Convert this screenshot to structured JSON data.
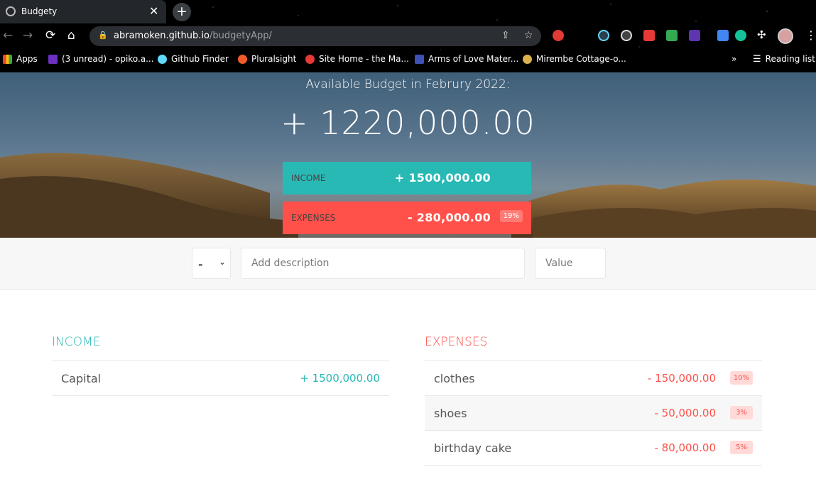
{
  "browser": {
    "tab_title": "Budgety",
    "tab_close": "✕",
    "new_tab": "+",
    "url_host": "abramoken.github.io",
    "url_path": "/budgetyApp/",
    "bookmarks": [
      {
        "label": "Apps",
        "color": "#e0533b"
      },
      {
        "label": "(3 unread) - opiko.a...",
        "color": "#6b2fc2"
      },
      {
        "label": "Github Finder",
        "color": "#61dafb"
      },
      {
        "label": "Pluralsight",
        "color": "#f15b2a"
      },
      {
        "label": "Site Home - the Ma...",
        "color": "#e53935"
      },
      {
        "label": "Arms of Love Mater...",
        "color": "#3f51b5"
      },
      {
        "label": "Mirembe Cottage-o...",
        "color": "#d9b24c"
      }
    ],
    "bookmarks_more": "»",
    "reading_list": "Reading list"
  },
  "header": {
    "title": "Available Budget in Februry 2022:",
    "budget": "+ 1220,000.00",
    "income_label": "Income",
    "income_value": "+ 1500,000.00",
    "expenses_label": "Expenses",
    "expenses_value": "- 280,000.00",
    "expenses_percent": "19%"
  },
  "add": {
    "type_value": "-",
    "description_placeholder": "Add description",
    "value_placeholder": "Value"
  },
  "income": {
    "title": "Income",
    "items": [
      {
        "description": "Capital",
        "value": "+ 1500,000.00"
      }
    ]
  },
  "expenses": {
    "title": "Expenses",
    "items": [
      {
        "description": "clothes",
        "value": "- 150,000.00",
        "percent": "10%"
      },
      {
        "description": "shoes",
        "value": "- 50,000.00",
        "percent": "3%"
      },
      {
        "description": "birthday cake",
        "value": "- 80,000.00",
        "percent": "5%"
      }
    ]
  },
  "colors": {
    "income": "#28b9b5",
    "expense": "#ff5049"
  }
}
